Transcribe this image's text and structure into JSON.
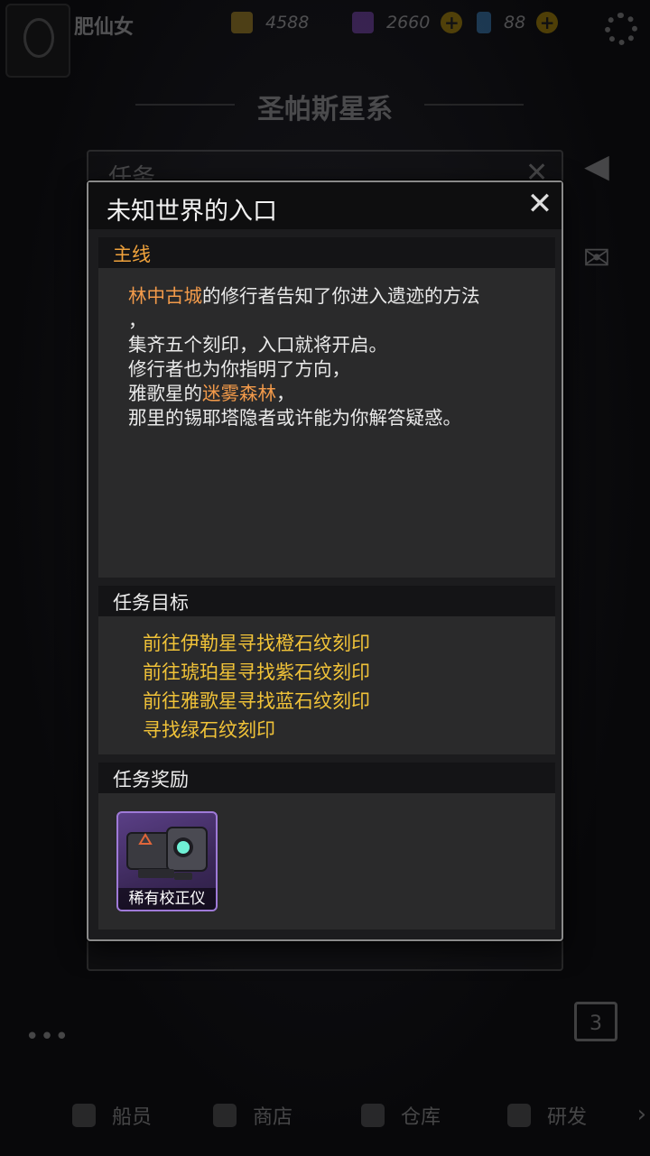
{
  "topbar": {
    "player_name": "肥仙女",
    "gold": "4588",
    "gems": "2660",
    "energy": "88"
  },
  "system_title": "圣帕斯星系",
  "background_panel": {
    "title": "任务"
  },
  "calendar_day": "3",
  "more_label": "•••",
  "nav": {
    "crew": "船员",
    "shop": "商店",
    "warehouse": "仓库",
    "research": "研发",
    "arrow": "›"
  },
  "dialog": {
    "title": "未知世界的入口",
    "close": "✕",
    "main_section": "主线",
    "story": {
      "line1_highlight": "林中古城",
      "line1_rest": "的修行者告知了你进入遗迹的方法",
      "line2": "，",
      "line3": "集齐五个刻印，入口就将开启。",
      "line4": "修行者也为你指明了方向，",
      "line5_prefix": "雅歌星的",
      "line5_highlight": "迷雾森林",
      "line5_suffix": "，",
      "line6": "那里的锡耶塔隐者或许能为你解答疑惑。"
    },
    "goals_section": "任务目标",
    "goals": [
      "前往伊勒星寻找橙石纹刻印",
      "前往琥珀星寻找紫石纹刻印",
      "前往雅歌星寻找蓝石纹刻印",
      "寻找绿石纹刻印"
    ],
    "rewards_section": "任务奖励",
    "reward_item": {
      "name": "稀有校正仪",
      "icon": "calibrator-device-icon"
    }
  },
  "colors": {
    "highlight": "#f29a4a",
    "goal": "#f0c238",
    "section_main": "#f0a23c",
    "reward_border": "#9f7ad8"
  }
}
